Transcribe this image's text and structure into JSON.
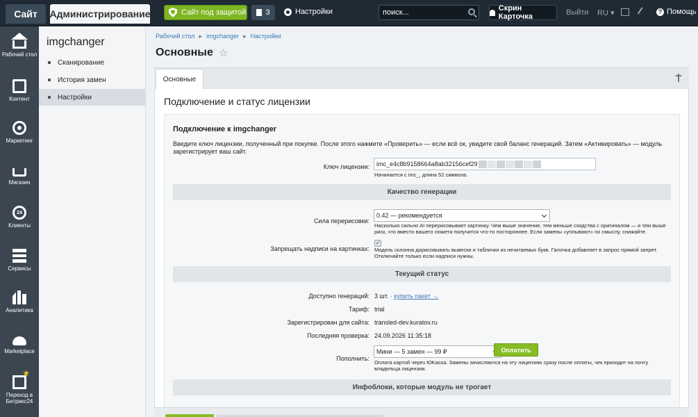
{
  "topbar": {
    "site_tab": "Сайт",
    "admin_tab": "Администрирование",
    "protect_label": "Сайт под защитой",
    "notif_count": "3",
    "settings_label": "Настройки",
    "search_placeholder": "поиск...",
    "user_label": "Скрин Карточка",
    "logout_label": "Выйти",
    "lang_label": "RU",
    "help_label": "Помощь",
    "accent_green": "#7db622",
    "bar_color": "#1f2a35"
  },
  "leftnav": {
    "items": [
      {
        "label": "Рабочий стол",
        "icon": "home-icon"
      },
      {
        "label": "Контент",
        "icon": "document-icon"
      },
      {
        "label": "Маркетинг",
        "icon": "target-icon"
      },
      {
        "label": "Магазин",
        "icon": "basket-icon"
      },
      {
        "label": "Клиенты",
        "icon": "clock-24-icon",
        "glyph": "24"
      },
      {
        "label": "Сервисы",
        "icon": "layers-icon"
      },
      {
        "label": "Аналитика",
        "icon": "bar-chart-icon"
      },
      {
        "label": "Marketplace",
        "icon": "cloud-icon"
      },
      {
        "label": "Переход в Битрикс24",
        "icon": "bitrix24-icon"
      }
    ]
  },
  "subnav": {
    "title": "imgchanger",
    "items": [
      {
        "label": "Сканирование"
      },
      {
        "label": "История замен"
      },
      {
        "label": "Настройки"
      }
    ]
  },
  "breadcrumb": {
    "items": [
      "Рабочий стол",
      "imgchanger",
      "Настройки"
    ],
    "separator": "▸"
  },
  "page": {
    "title": "Основные",
    "tab_label": "Основные"
  },
  "section": {
    "title": "Подключение и статус лицензии",
    "block_title": "Подключение к imgchanger",
    "block_desc": "Введите ключ лицензии, полученный при покупке. После этого нажмите «Проверить» — если всё ок, увидите свой баланс генераций. Затем «Активировать» — модуль зарегистрирует ваш сайт."
  },
  "license": {
    "label": "Ключ лицензии:",
    "value": "imc_e4c8b9158664a8ab32156cef29",
    "hint": "Начинается с imc_, длина 52 символа."
  },
  "quality": {
    "header": "Качество генерации",
    "strength_label": "Сила перерисовки:",
    "strength_value": "0.42 — рекомендуется",
    "strength_hint": "Насколько сильно AI перерисовывает картинку. Чем выше значение, тем меньше сходства с оригиналом — и тем выше риск, что вместо вашего сюжета получится что-то постороннее. Если замены «уплывают» по смыслу, снижайте.",
    "forbid_label": "Запрещать надписи на картинках:",
    "forbid_checked": true,
    "forbid_hint": "Модель склонна дорисовывать вывески и таблички из нечитаемых букв. Галочка добавляет в запрос прямой запрет. Отключайте только если надписи нужны."
  },
  "status": {
    "header": "Текущий статус",
    "available_label": "Доступно генераций:",
    "available_value": "3 шт.",
    "available_sep": "·",
    "buy_link": "купить пакет →",
    "tariff_label": "Тариф:",
    "tariff_value": "trial",
    "site_label": "Зарегистрирован для сайта:",
    "site_value": "transled-dev.kuratov.ru",
    "check_label": "Последняя проверка:",
    "check_value": "24.09.2026 11:35:18",
    "topup_label": "Пополнить:",
    "topup_value": "Мини — 5 замен — 99 ₽",
    "pay_button": "Оплатить",
    "topup_hint": "Оплата картой через ЮKassa. Замены зачисляются на эту лицензию сразу после оплаты, чек приходит на почту владельца лицензии."
  },
  "infoblocks": {
    "header": "Инфоблоки, которые модуль не трогает"
  }
}
